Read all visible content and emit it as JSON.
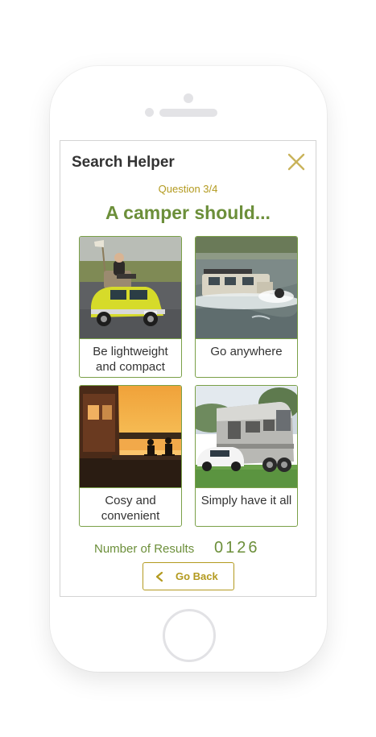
{
  "header": {
    "title": "Search Helper",
    "close_icon": "close-icon"
  },
  "quiz": {
    "question_number": "Question 3/4",
    "question": "A camper should..."
  },
  "options": [
    {
      "label": "Be lightweight and compact",
      "image": "mini-car-with-armchair-photo"
    },
    {
      "label": "Go anywhere",
      "image": "offroad-truck-in-river-photo"
    },
    {
      "label": "Cosy and convenient",
      "image": "sunset-lake-camping-photo"
    },
    {
      "label": "Simply have it all",
      "image": "luxury-motorhome-photo"
    }
  ],
  "results": {
    "label": "Number of Results",
    "count": "0126"
  },
  "footer": {
    "back_label": "Go Back",
    "back_icon": "chevron-left-icon"
  },
  "colors": {
    "accent_green": "#6c8f3a",
    "accent_gold": "#b39a1f",
    "border_green": "#7aa048"
  }
}
